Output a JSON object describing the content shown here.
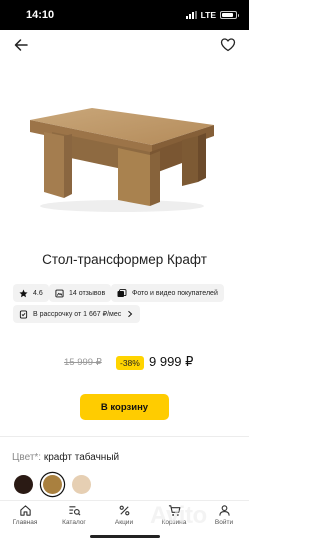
{
  "status_bar": {
    "time": "14:10",
    "network": "LTE"
  },
  "header": {
    "back_icon": "arrow-left-icon",
    "favorite_icon": "heart-icon"
  },
  "product": {
    "title": "Стол-трансформер Крафт",
    "rating": "4.6",
    "reviews": "14 отзывов",
    "media": "Фото и видео покупателей",
    "installment": "В рассрочку от 1 667 ₽/мес"
  },
  "price": {
    "old": "15 999 ₽",
    "discount": "-38%",
    "new": "9 999 ₽"
  },
  "cart_button": "В корзину",
  "color": {
    "label": "Цвет*:",
    "value": "крафт табачный",
    "swatches": [
      {
        "name": "dark-brown",
        "hex": "#2a1a14",
        "selected": false
      },
      {
        "name": "kraft-tobacco",
        "hex": "#a9803f",
        "selected": true
      },
      {
        "name": "beige",
        "hex": "#e6cfb3",
        "selected": false
      }
    ]
  },
  "tabbar": {
    "items": [
      {
        "label": "Главная",
        "icon": "home-icon"
      },
      {
        "label": "Каталог",
        "icon": "catalog-search-icon"
      },
      {
        "label": "Акции",
        "icon": "percent-icon"
      },
      {
        "label": "Корзина",
        "icon": "cart-icon"
      },
      {
        "label": "Войти",
        "icon": "user-icon"
      }
    ]
  },
  "watermark": "Avito"
}
